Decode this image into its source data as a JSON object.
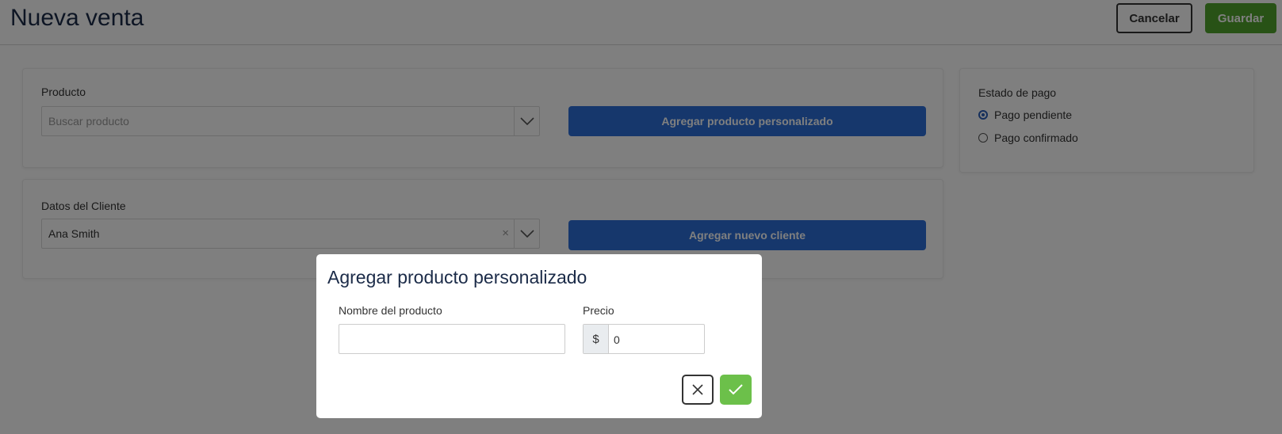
{
  "header": {
    "title": "Nueva venta",
    "cancel_label": "Cancelar",
    "save_label": "Guardar"
  },
  "product_section": {
    "label": "Producto",
    "search_placeholder": "Buscar producto",
    "add_custom_label": "Agregar producto personalizado"
  },
  "client_section": {
    "label": "Datos del Cliente",
    "selected_client": "Ana Smith",
    "clear_symbol": "×",
    "add_client_label": "Agregar nuevo cliente"
  },
  "payment_section": {
    "label": "Estado de pago",
    "options": [
      {
        "label": "Pago pendiente",
        "checked": true
      },
      {
        "label": "Pago confirmado",
        "checked": false
      }
    ]
  },
  "modal": {
    "title": "Agregar producto personalizado",
    "name_label": "Nombre del producto",
    "name_value": "",
    "price_label": "Precio",
    "currency_symbol": "$",
    "price_value": "0"
  },
  "icons": {
    "dropdown": "chevron-down-icon",
    "clear": "clear-icon",
    "close": "close-icon",
    "confirm": "check-icon"
  },
  "colors": {
    "title": "#1b2b48",
    "primary": "#2c6fd9",
    "save": "#51a52d",
    "confirm": "#6cc04a",
    "radio_selected": "#2b5fb8"
  }
}
